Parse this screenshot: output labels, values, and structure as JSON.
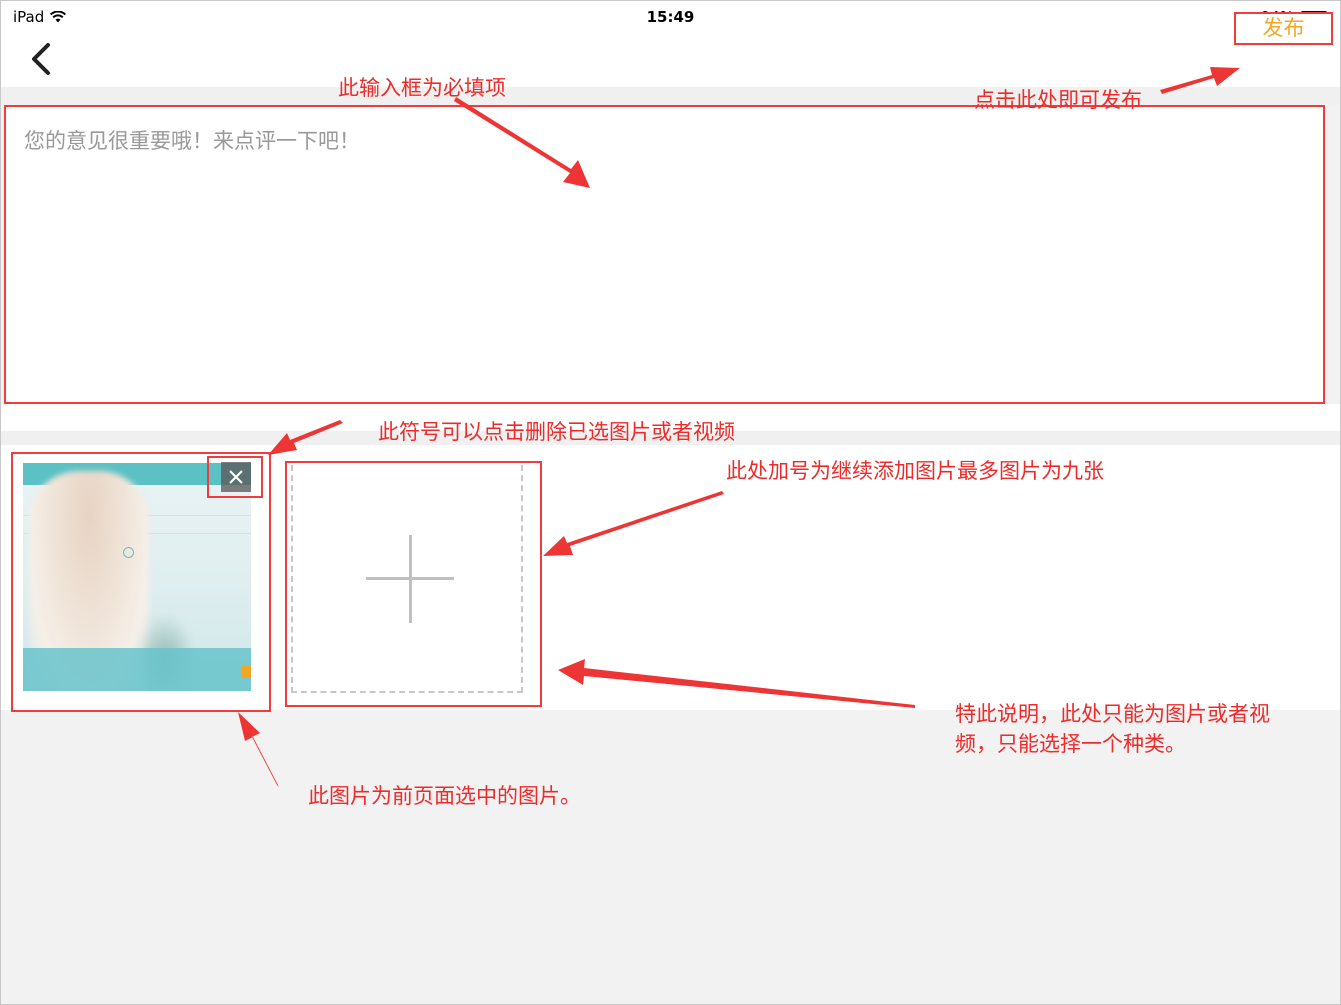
{
  "status_bar": {
    "device": "iPad",
    "time": "15:49",
    "battery": "94%",
    "battery_level": 0.94,
    "wifi_icon": "wifi-icon"
  },
  "nav": {
    "back_icon": "chevron-left-icon",
    "publish_label": "发布"
  },
  "feedback": {
    "placeholder": "您的意见很重要哦！来点评一下吧！",
    "value": ""
  },
  "media": {
    "delete_icon": "close-icon",
    "add_icon": "plus-icon"
  },
  "annotations": {
    "required_input": "此输入框为必填项",
    "publish_hint": "点击此处即可发布",
    "delete_hint": "此符号可以点击删除已选图片或者视频",
    "add_hint": "此处加号为继续添加图片最多图片为九张",
    "type_hint_line1": "特此说明，此处只能为图片或者视",
    "type_hint_line2": "频，只能选择一个种类。",
    "thumbnail_hint": "此图片为前页面选中的图片。"
  },
  "colors": {
    "annotation_red": "#ee2b2b",
    "publish_orange": "#f5a623",
    "background_gray": "#f2f2f2"
  }
}
